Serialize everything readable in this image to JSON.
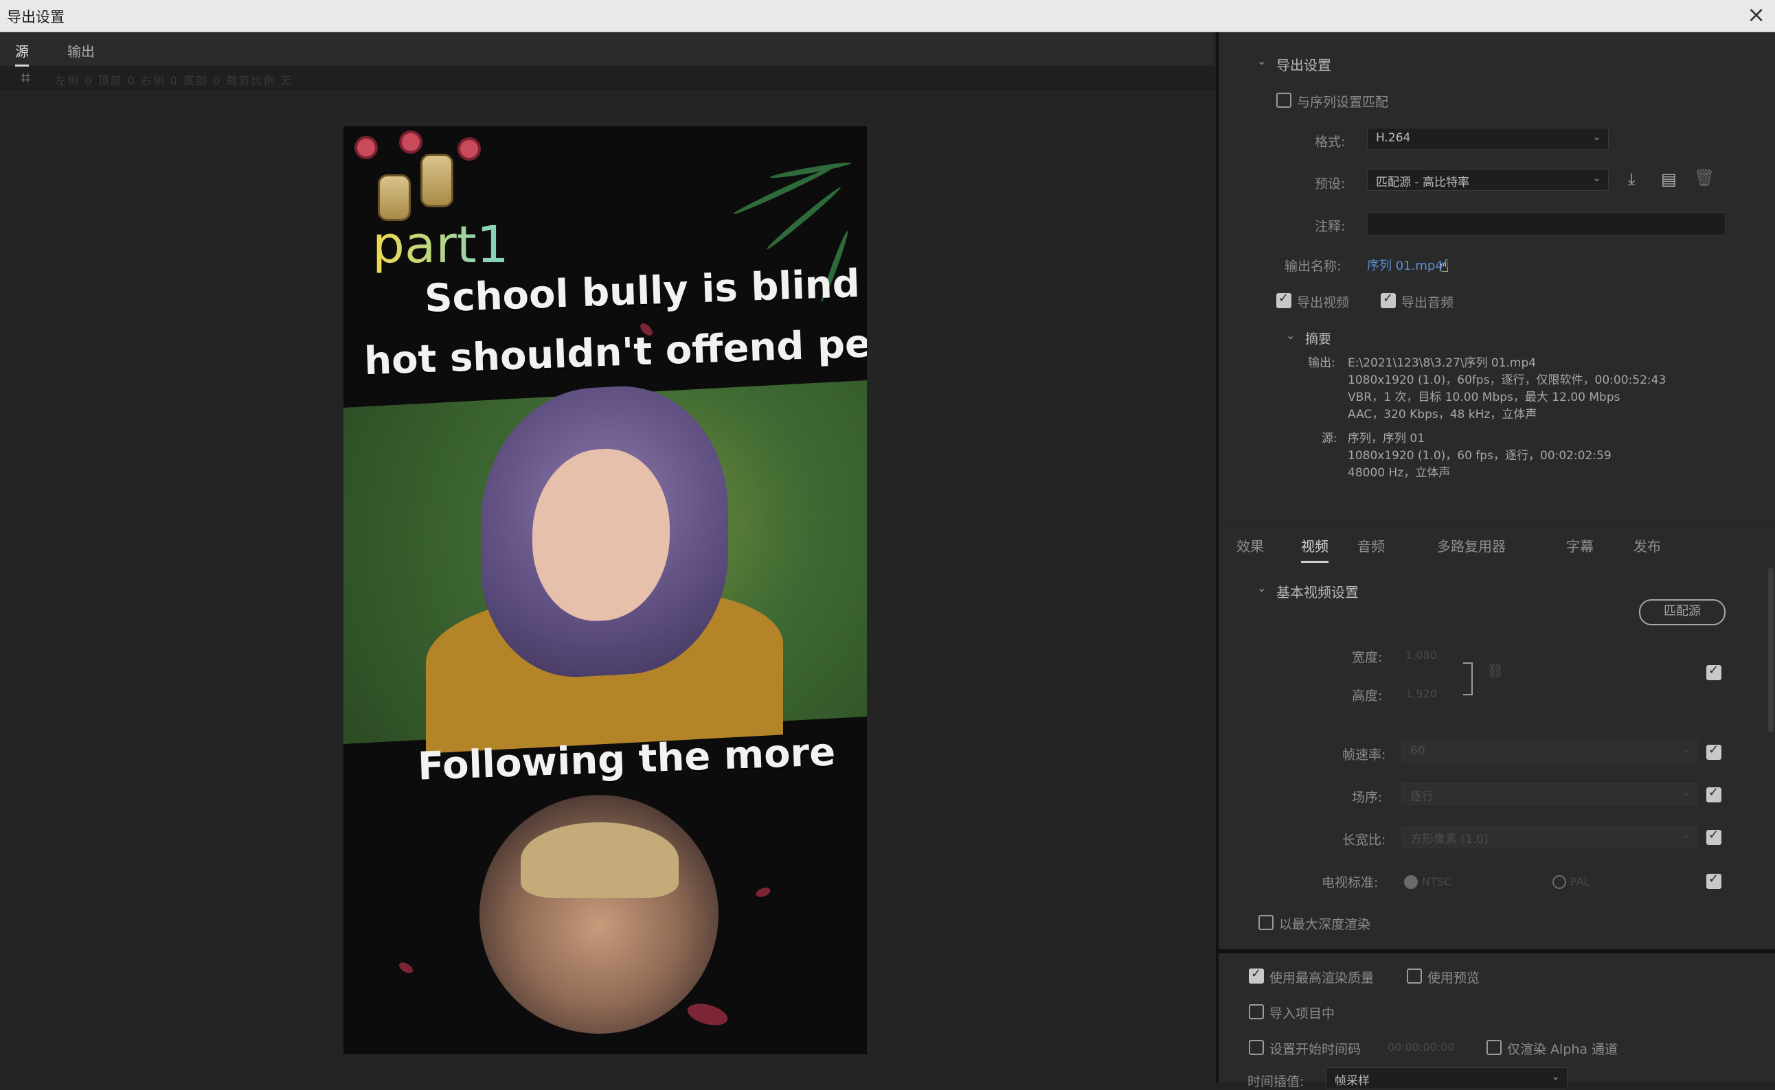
{
  "window": {
    "title": "导出设置",
    "close_glyph": "×"
  },
  "left_tabs": [
    "源",
    "输出"
  ],
  "toolbar": {
    "crop_icon": "crop-icon",
    "faint_text": "左侧 0  顶部 0  右侧 0  底部 0  裁剪比例 无"
  },
  "video": {
    "part_label": "part1",
    "caption_line1": "School bully is blind",
    "caption_line2": "hot shouldn't offend people",
    "caption_line3": "Following the more"
  },
  "export_settings": {
    "section_title": "导出设置",
    "match_sequence_label": "与序列设置匹配",
    "match_sequence_checked": false,
    "format_label": "格式:",
    "format_value": "H.264",
    "preset_label": "预设:",
    "preset_value": "匹配源 - 高比特率",
    "comment_label": "注释:",
    "output_name_label": "输出名称:",
    "output_name_value": "序列 01.mp4",
    "export_video_label": "导出视频",
    "export_video_checked": true,
    "export_audio_label": "导出音频",
    "export_audio_checked": true
  },
  "summary": {
    "title": "摘要",
    "output_label": "输出:",
    "output_lines": [
      "E:\\2021\\123\\8\\3.27\\序列 01.mp4",
      "1080x1920 (1.0)，60fps，逐行，仅限软件，00:00:52:43",
      "VBR，1 次，目标 10.00 Mbps，最大 12.00 Mbps",
      "AAC，320 Kbps，48 kHz，立体声"
    ],
    "source_label": "源:",
    "source_lines": [
      "序列，序列 01",
      "1080x1920 (1.0)，60 fps，逐行，00:02:02:59",
      "48000 Hz，立体声"
    ]
  },
  "right_tabs": [
    "效果",
    "视频",
    "音频",
    "多路复用器",
    "字幕",
    "发布"
  ],
  "active_right_tab": 1,
  "basic_video": {
    "section_title": "基本视频设置",
    "match_source_button": "匹配源",
    "width_label": "宽度:",
    "width_value": "1,080",
    "height_label": "高度:",
    "height_value": "1,920",
    "frame_rate_label": "帧速率:",
    "frame_rate_value": "60",
    "field_order_label": "场序:",
    "field_order_value": "逐行",
    "aspect_label": "长宽比:",
    "aspect_value": "方形像素 (1.0)",
    "tv_standard_label": "电视标准:",
    "ntsc_label": "NTSC",
    "pal_label": "PAL",
    "max_depth_label": "以最大深度渲染",
    "max_depth_checked": false
  },
  "bottom_options": {
    "max_quality_label": "使用最高渲染质量",
    "max_quality_checked": true,
    "use_previews_label": "使用预览",
    "use_previews_checked": false,
    "import_project_label": "导入项目中",
    "import_project_checked": false,
    "start_timecode_label": "设置开始时间码",
    "start_timecode_value": "00:00:00:00",
    "start_timecode_checked": false,
    "alpha_only_label": "仅渲染 Alpha 通道",
    "alpha_only_checked": false,
    "time_interp_label": "时间插值:",
    "time_interp_value": "帧采样"
  },
  "colors": {
    "accent_link": "#5b8fd6",
    "panel_bg": "#2a2a2a",
    "left_bg": "#242424"
  }
}
